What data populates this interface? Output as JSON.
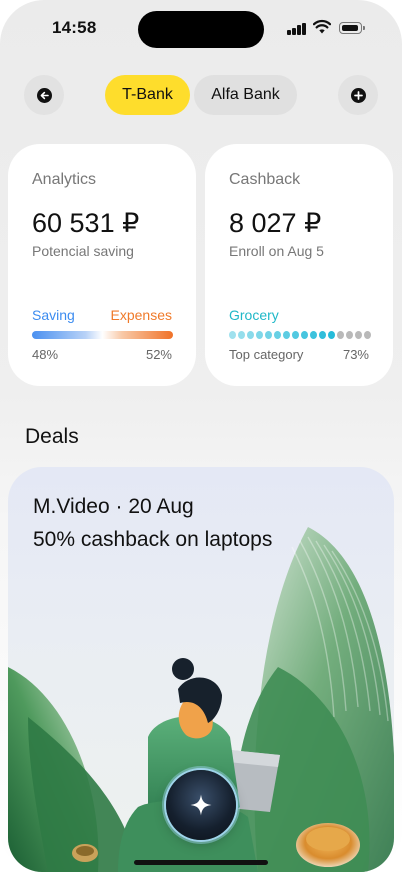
{
  "status_bar": {
    "time": "14:58"
  },
  "header": {
    "tabs": [
      {
        "label": "T-Bank",
        "active": true
      },
      {
        "label": "Alfa Bank",
        "active": false
      }
    ]
  },
  "analytics": {
    "title": "Analytics",
    "value": "60 531 ₽",
    "subtitle": "Potencial saving",
    "left_label": "Saving",
    "right_label": "Expenses",
    "left_percent": "48%",
    "right_percent": "52%",
    "saving_share": 0.48
  },
  "cashback": {
    "title": "Cashback",
    "value": "8 027 ₽",
    "subtitle": "Enroll on Aug 5",
    "category_label": "Grocery",
    "caption": "Top category",
    "percent": "73%",
    "share": 0.73
  },
  "deals": {
    "title": "Deals",
    "card": {
      "merchant_date": "M.Video · 20 Aug",
      "offer": "50% cashback on laptops"
    }
  },
  "icons": {
    "back": "back-arrow-icon",
    "add": "plus-icon",
    "assistant": "sparkle-icon"
  },
  "colors": {
    "accent_yellow": "#fedd2c",
    "saving_blue": "#3c8cf0",
    "expenses_orange": "#f07a2a",
    "grocery_teal": "#20b8c8"
  }
}
